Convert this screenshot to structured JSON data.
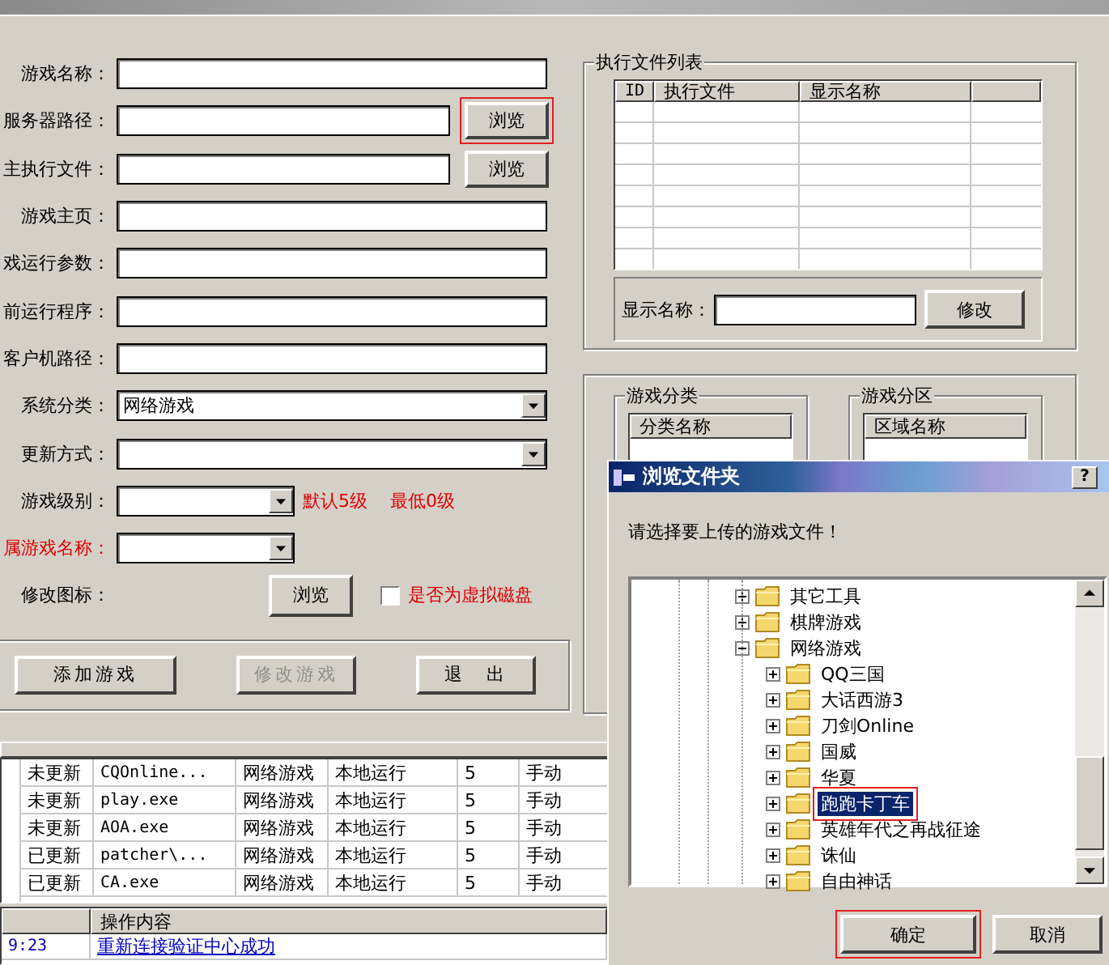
{
  "form": {
    "fields": [
      {
        "label": "游戏名称：",
        "kind": "text",
        "alert": false
      },
      {
        "label": "服务器路径：",
        "kind": "browse",
        "alert": false,
        "button": {
          "label": "浏览",
          "marked": true
        }
      },
      {
        "label": "主执行文件：",
        "kind": "browse",
        "alert": false,
        "button": {
          "label": "浏览",
          "marked": false
        }
      },
      {
        "label": "游戏主页：",
        "kind": "text",
        "alert": false
      },
      {
        "label": "戏运行参数：",
        "kind": "text",
        "alert": false
      },
      {
        "label": "前运行程序：",
        "kind": "text",
        "alert": false
      },
      {
        "label": "客户机路径：",
        "kind": "text",
        "alert": false
      },
      {
        "label": "系统分类：",
        "kind": "select",
        "alert": false,
        "value": "网络游戏"
      },
      {
        "label": "更新方式：",
        "kind": "select",
        "alert": false
      },
      {
        "label": "游戏级别：",
        "kind": "short_select",
        "alert": false,
        "hints": [
          "默认5级",
          "最低0级"
        ]
      },
      {
        "label": "属游戏名称：",
        "kind": "short_select",
        "alert": true
      },
      {
        "label": "修改图标：",
        "kind": "icon",
        "alert": false,
        "button": {
          "label": "浏览",
          "marked": false
        },
        "checkbox": {
          "label": "是否为虚拟磁盘",
          "checked": false
        }
      }
    ],
    "actions": [
      {
        "label": "添加游戏",
        "disabled": false
      },
      {
        "label": "修改游戏",
        "disabled": true
      },
      {
        "label": "退　出",
        "disabled": false
      }
    ]
  },
  "exec_files": {
    "title": "执行文件列表",
    "columns": [
      "ID",
      "执行文件",
      "显示名称"
    ],
    "display_name_label": "显示名称：",
    "edit_button": "修改"
  },
  "categories": {
    "title": "游戏分类",
    "column": "分类名称"
  },
  "zones": {
    "title": "游戏分区",
    "column": "区域名称"
  },
  "games_table": {
    "rows": [
      [
        "未更新",
        "CQOnline...",
        "网络游戏",
        "本地运行",
        "5",
        "手动"
      ],
      [
        "未更新",
        "play.exe",
        "网络游戏",
        "本地运行",
        "5",
        "手动"
      ],
      [
        "未更新",
        "AOA.exe",
        "网络游戏",
        "本地运行",
        "5",
        "手动"
      ],
      [
        "已更新",
        "patcher\\...",
        "网络游戏",
        "本地运行",
        "5",
        "手动"
      ],
      [
        "已更新",
        "CA.exe",
        "网络游戏",
        "本地运行",
        "5",
        "手动"
      ]
    ]
  },
  "log_table": {
    "column_2": "操作内容",
    "rows": [
      [
        "9:23",
        "重新连接验证中心成功"
      ]
    ]
  },
  "dialog": {
    "title": "浏览文件夹",
    "help": "?",
    "prompt": "请选择要上传的游戏文件！",
    "tree": [
      {
        "label": "其它工具",
        "expanded": false,
        "selected": false
      },
      {
        "label": "棋牌游戏",
        "expanded": false,
        "selected": false
      },
      {
        "label": "网络游戏",
        "expanded": true,
        "selected": false,
        "children": [
          {
            "label": "QQ三国",
            "expanded": false,
            "selected": false
          },
          {
            "label": "大话西游3",
            "expanded": false,
            "selected": false
          },
          {
            "label": "刀剑Online",
            "expanded": false,
            "selected": false
          },
          {
            "label": "国威",
            "expanded": false,
            "selected": false
          },
          {
            "label": "华夏",
            "expanded": false,
            "selected": false
          },
          {
            "label": "跑跑卡丁车",
            "expanded": false,
            "selected": true
          },
          {
            "label": "英雄年代之再战征途",
            "expanded": false,
            "selected": false
          },
          {
            "label": "诛仙",
            "expanded": false,
            "selected": false
          },
          {
            "label": "自由神话",
            "expanded": false,
            "selected": false
          }
        ]
      }
    ],
    "buttons": [
      {
        "label": "确定",
        "marked": true
      },
      {
        "label": "取消",
        "marked": false
      }
    ]
  }
}
